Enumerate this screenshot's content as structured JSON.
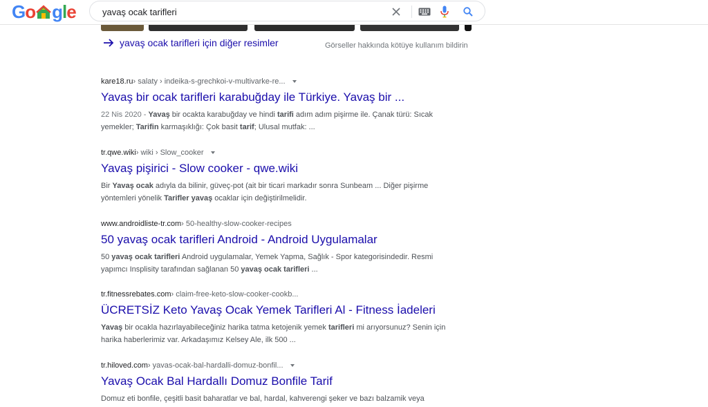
{
  "search": {
    "query": "yavaş ocak tarifleri"
  },
  "images": {
    "more_label": "yavaş ocak tarifleri için diğer resimler",
    "report_label": "Görseller hakkında kötüye kullanım bildirin"
  },
  "results": [
    {
      "domain": "kare18.ru",
      "path": " › salaty › indeika-s-grechkoi-v-multivarke-re...",
      "has_menu": true,
      "title": "Yavaş bir ocak tarifleri karabuğday ile Türkiye. Yavaş bir ...",
      "snippet_html": "<span class=\"date\">22 Nis 2020 - </span><b>Yavaş</b> bir ocakta karabuğday ve hindi <b>tarifi</b> adım adım pişirme ile. Çanak türü: Sıcak yemekler; <b>Tarifin</b> karmaşıklığı: Çok basit <b>tarif</b>; Ulusal mutfak: ..."
    },
    {
      "domain": "tr.qwe.wiki",
      "path": " › wiki › Slow_cooker",
      "has_menu": true,
      "title": "Yavaş pişirici - Slow cooker - qwe.wiki",
      "snippet_html": "Bir <b>Yavaş ocak</b> adıyla da bilinir, güveç-pot (ait bir ticari markadır sonra Sunbeam ... Diğer pişirme yöntemleri yönelik <b>Tarifler yavaş</b> ocaklar için değiştirilmelidir."
    },
    {
      "domain": "www.androidliste-tr.com",
      "path": " › 50-healthy-slow-cooker-recipes",
      "has_menu": false,
      "title": "50 yavaş ocak tarifleri Android - Android Uygulamalar",
      "snippet_html": "50 <b>yavaş ocak tarifleri</b> Android uygulamalar, Yemek Yapma, Sağlık - Spor kategorisindedir. Resmi yapımcı Insplisity tarafından sağlanan 50 <b>yavaş ocak tarifleri</b> ..."
    },
    {
      "domain": "tr.fitnessrebates.com",
      "path": " › claim-free-keto-slow-cooker-cookb...",
      "has_menu": false,
      "title": "ÜCRETSİZ Keto Yavaş Ocak Yemek Tarifleri Al - Fitness İadeleri",
      "snippet_html": "<b>Yavaş</b> bir ocakla hazırlayabileceğiniz harika tatma ketojenik yemek <b>tarifleri</b> mi arıyorsunuz? Senin için harika haberlerimiz var. Arkadaşımız Kelsey Ale, ilk 500 ..."
    },
    {
      "domain": "tr.hiloved.com",
      "path": " › yavas-ocak-bal-hardalli-domuz-bonfil...",
      "has_menu": true,
      "title": "Yavaş Ocak Bal Hardallı Domuz Bonfile Tarif",
      "snippet_html": "Domuz eti bonfile, çeşitli basit baharatlar ve bal, hardal, kahverengi şeker ve bazı balzamik veya"
    }
  ],
  "colors": {
    "link": "#1a0dab",
    "snippet": "#4d5156",
    "meta": "#70757a"
  }
}
